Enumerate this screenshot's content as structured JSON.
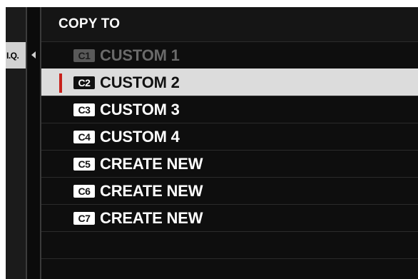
{
  "sidebar": {
    "tab_label": "I.Q."
  },
  "header": {
    "title": "COPY TO"
  },
  "items": [
    {
      "badge": "C1",
      "label": "CUSTOM 1"
    },
    {
      "badge": "C2",
      "label": "CUSTOM 2"
    },
    {
      "badge": "C3",
      "label": "CUSTOM 3"
    },
    {
      "badge": "C4",
      "label": "CUSTOM 4"
    },
    {
      "badge": "C5",
      "label": "CREATE NEW"
    },
    {
      "badge": "C6",
      "label": "CREATE NEW"
    },
    {
      "badge": "C7",
      "label": "CREATE NEW"
    }
  ],
  "selected_item": "CUSTOM 2",
  "disabled_item": "CUSTOM 1",
  "colors": {
    "selection_marker": "#c8221c",
    "selection_bg": "#dcdcdc",
    "background": "#0e0e0e"
  }
}
